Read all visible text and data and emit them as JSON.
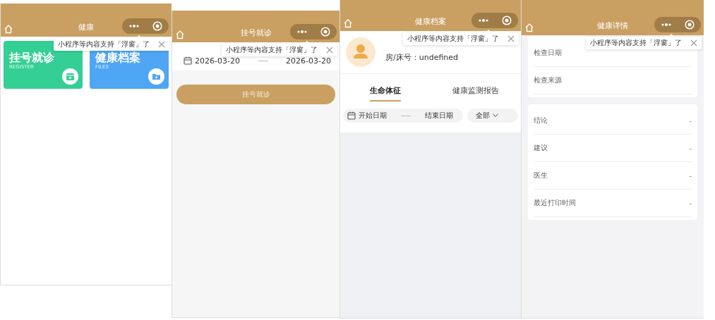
{
  "panels": [
    {
      "kind": "home",
      "title": "健康",
      "tip": "小程序等内容支持「浮窗」了",
      "cards": [
        {
          "title": "挂号就诊",
          "subtitle": "REGISTER",
          "color": "#34cf95"
        },
        {
          "title": "健康档案",
          "subtitle": "FILES",
          "color": "#4ea6f5"
        }
      ]
    },
    {
      "kind": "register",
      "title": "挂号就诊",
      "tip": "小程序等内容支持「浮窗」了",
      "start_date": "2026-03-20",
      "end_date": "2026-03-20",
      "button": "挂号就诊"
    },
    {
      "kind": "archive",
      "title": "健康档案",
      "tip": "小程序等内容支持「浮窗」了",
      "room_label": "房/床号：undefined",
      "tabs": [
        {
          "label": "生命体征",
          "selected": true
        },
        {
          "label": "健康监测报告",
          "selected": false
        }
      ],
      "filter": {
        "start_placeholder": "开始日期",
        "end_placeholder": "结束日期",
        "category": "全部"
      }
    },
    {
      "kind": "detail",
      "title": "健康详情",
      "tip": "小程序等内容支持「浮窗」了",
      "groups": [
        {
          "fields": [
            {
              "label": "检查日期"
            },
            {
              "label": "检查来源"
            }
          ]
        },
        {
          "fields": [
            {
              "label": "结论",
              "value": "-"
            },
            {
              "label": "建议",
              "value": "-"
            },
            {
              "label": "医生",
              "value": "-"
            },
            {
              "label": "最近打印时间",
              "value": "-"
            }
          ]
        }
      ]
    }
  ]
}
